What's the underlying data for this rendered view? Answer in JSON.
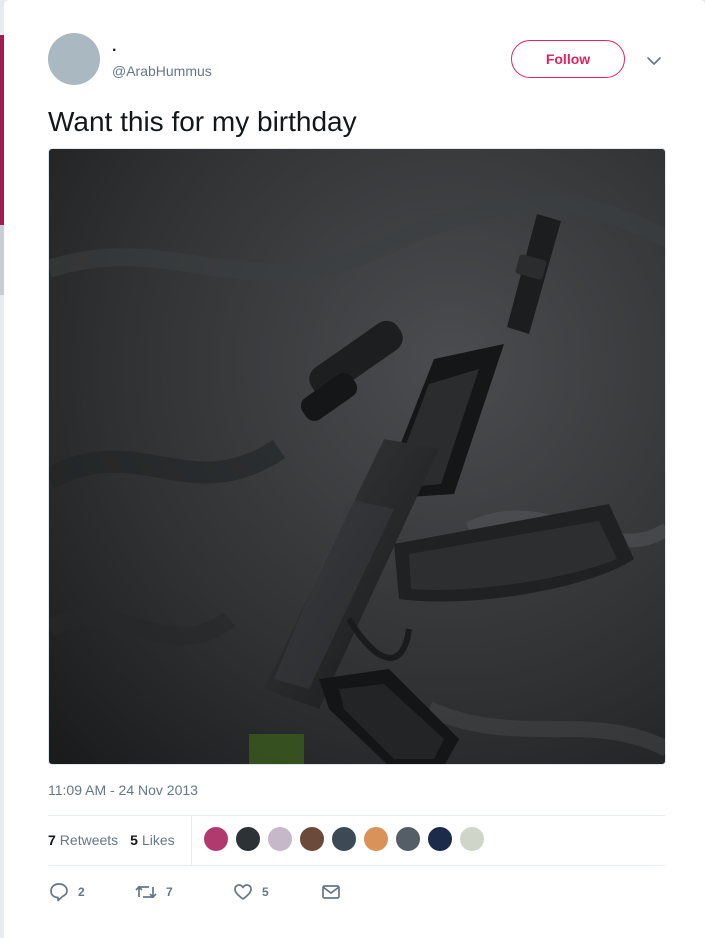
{
  "tweet": {
    "display_name": ".",
    "handle": "@ArabHummus",
    "follow_label": "Follow",
    "text": "Want this for my birthday",
    "timestamp": "11:09 AM - 24 Nov 2013"
  },
  "stats": {
    "retweets_count": "7",
    "retweets_label": "Retweets",
    "likes_count": "5",
    "likes_label": "Likes"
  },
  "likers": [
    "#b03a6e",
    "#2d3236",
    "#c6b7c9",
    "#6b4a3a",
    "#3b4a55",
    "#d9935a",
    "#555d66",
    "#1d2b4a",
    "#cfd6c9"
  ],
  "actions": {
    "reply_count": "2",
    "retweet_count": "7",
    "like_count": "5"
  },
  "colors": {
    "accent": "#e0245e",
    "muted": "#657786",
    "brand_stripe": "#a21d4f"
  }
}
